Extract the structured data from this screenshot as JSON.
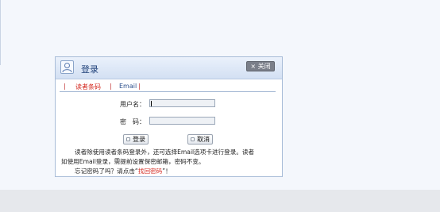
{
  "dialog": {
    "title": "登录",
    "close_label": "× 关闭",
    "tabs": [
      {
        "label": "读者条码"
      },
      {
        "label": "Email"
      }
    ],
    "separator": "|",
    "username_label": "用户名：",
    "password_label": "密　码：",
    "login_button": "登录",
    "cancel_button": "取消",
    "note_line1": "读者除使用读者条码登录外，还可选择Email选项卡进行登录。读者",
    "note_line2": "如使用Email登录，需提前设置保密邮箱，密码不变。",
    "forgot_prefix": "忘记密码了吗？请点击“",
    "forgot_link": "找回密码",
    "forgot_suffix": "”！"
  },
  "colors": {
    "accent_red": "#d3261d",
    "header_blue": "#d3e0f3",
    "border_blue": "#a9bdd8"
  }
}
